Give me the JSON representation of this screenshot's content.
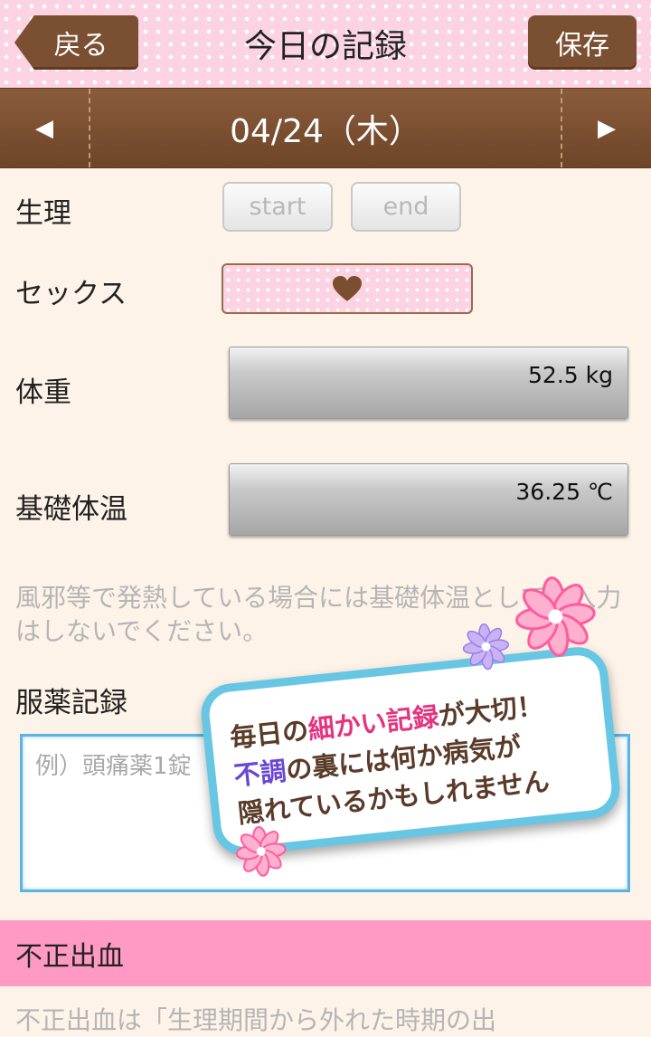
{
  "header": {
    "back_label": "戻る",
    "title": "今日の記録",
    "save_label": "保存"
  },
  "datebar": {
    "date": "04/24（木）"
  },
  "period": {
    "label": "生理",
    "start_label": "start",
    "end_label": "end"
  },
  "sex": {
    "label": "セックス",
    "icon": "heart-icon"
  },
  "weight": {
    "label": "体重",
    "value": "52.5 kg"
  },
  "temperature": {
    "label": "基礎体温",
    "value": "36.25 ℃",
    "note": "風邪等で発熱している場合には基礎体温としての入力はしないでください。"
  },
  "medication": {
    "label": "服薬記録",
    "placeholder": "例）頭痛薬1錠"
  },
  "promo": {
    "line1_a": "毎日の",
    "line1_b": "細かい記録",
    "line1_c": "が大切！",
    "line2_a": "不調",
    "line2_b": "の裏には何か病気が",
    "line3": "隠れているかもしれません"
  },
  "bleeding": {
    "title": "不正出血",
    "note": "不正出血は「生理期間から外れた時期の出"
  },
  "colors": {
    "brown": "#7b4f32",
    "pink": "#ff9ac4",
    "accent_blue": "#66c6e4"
  }
}
